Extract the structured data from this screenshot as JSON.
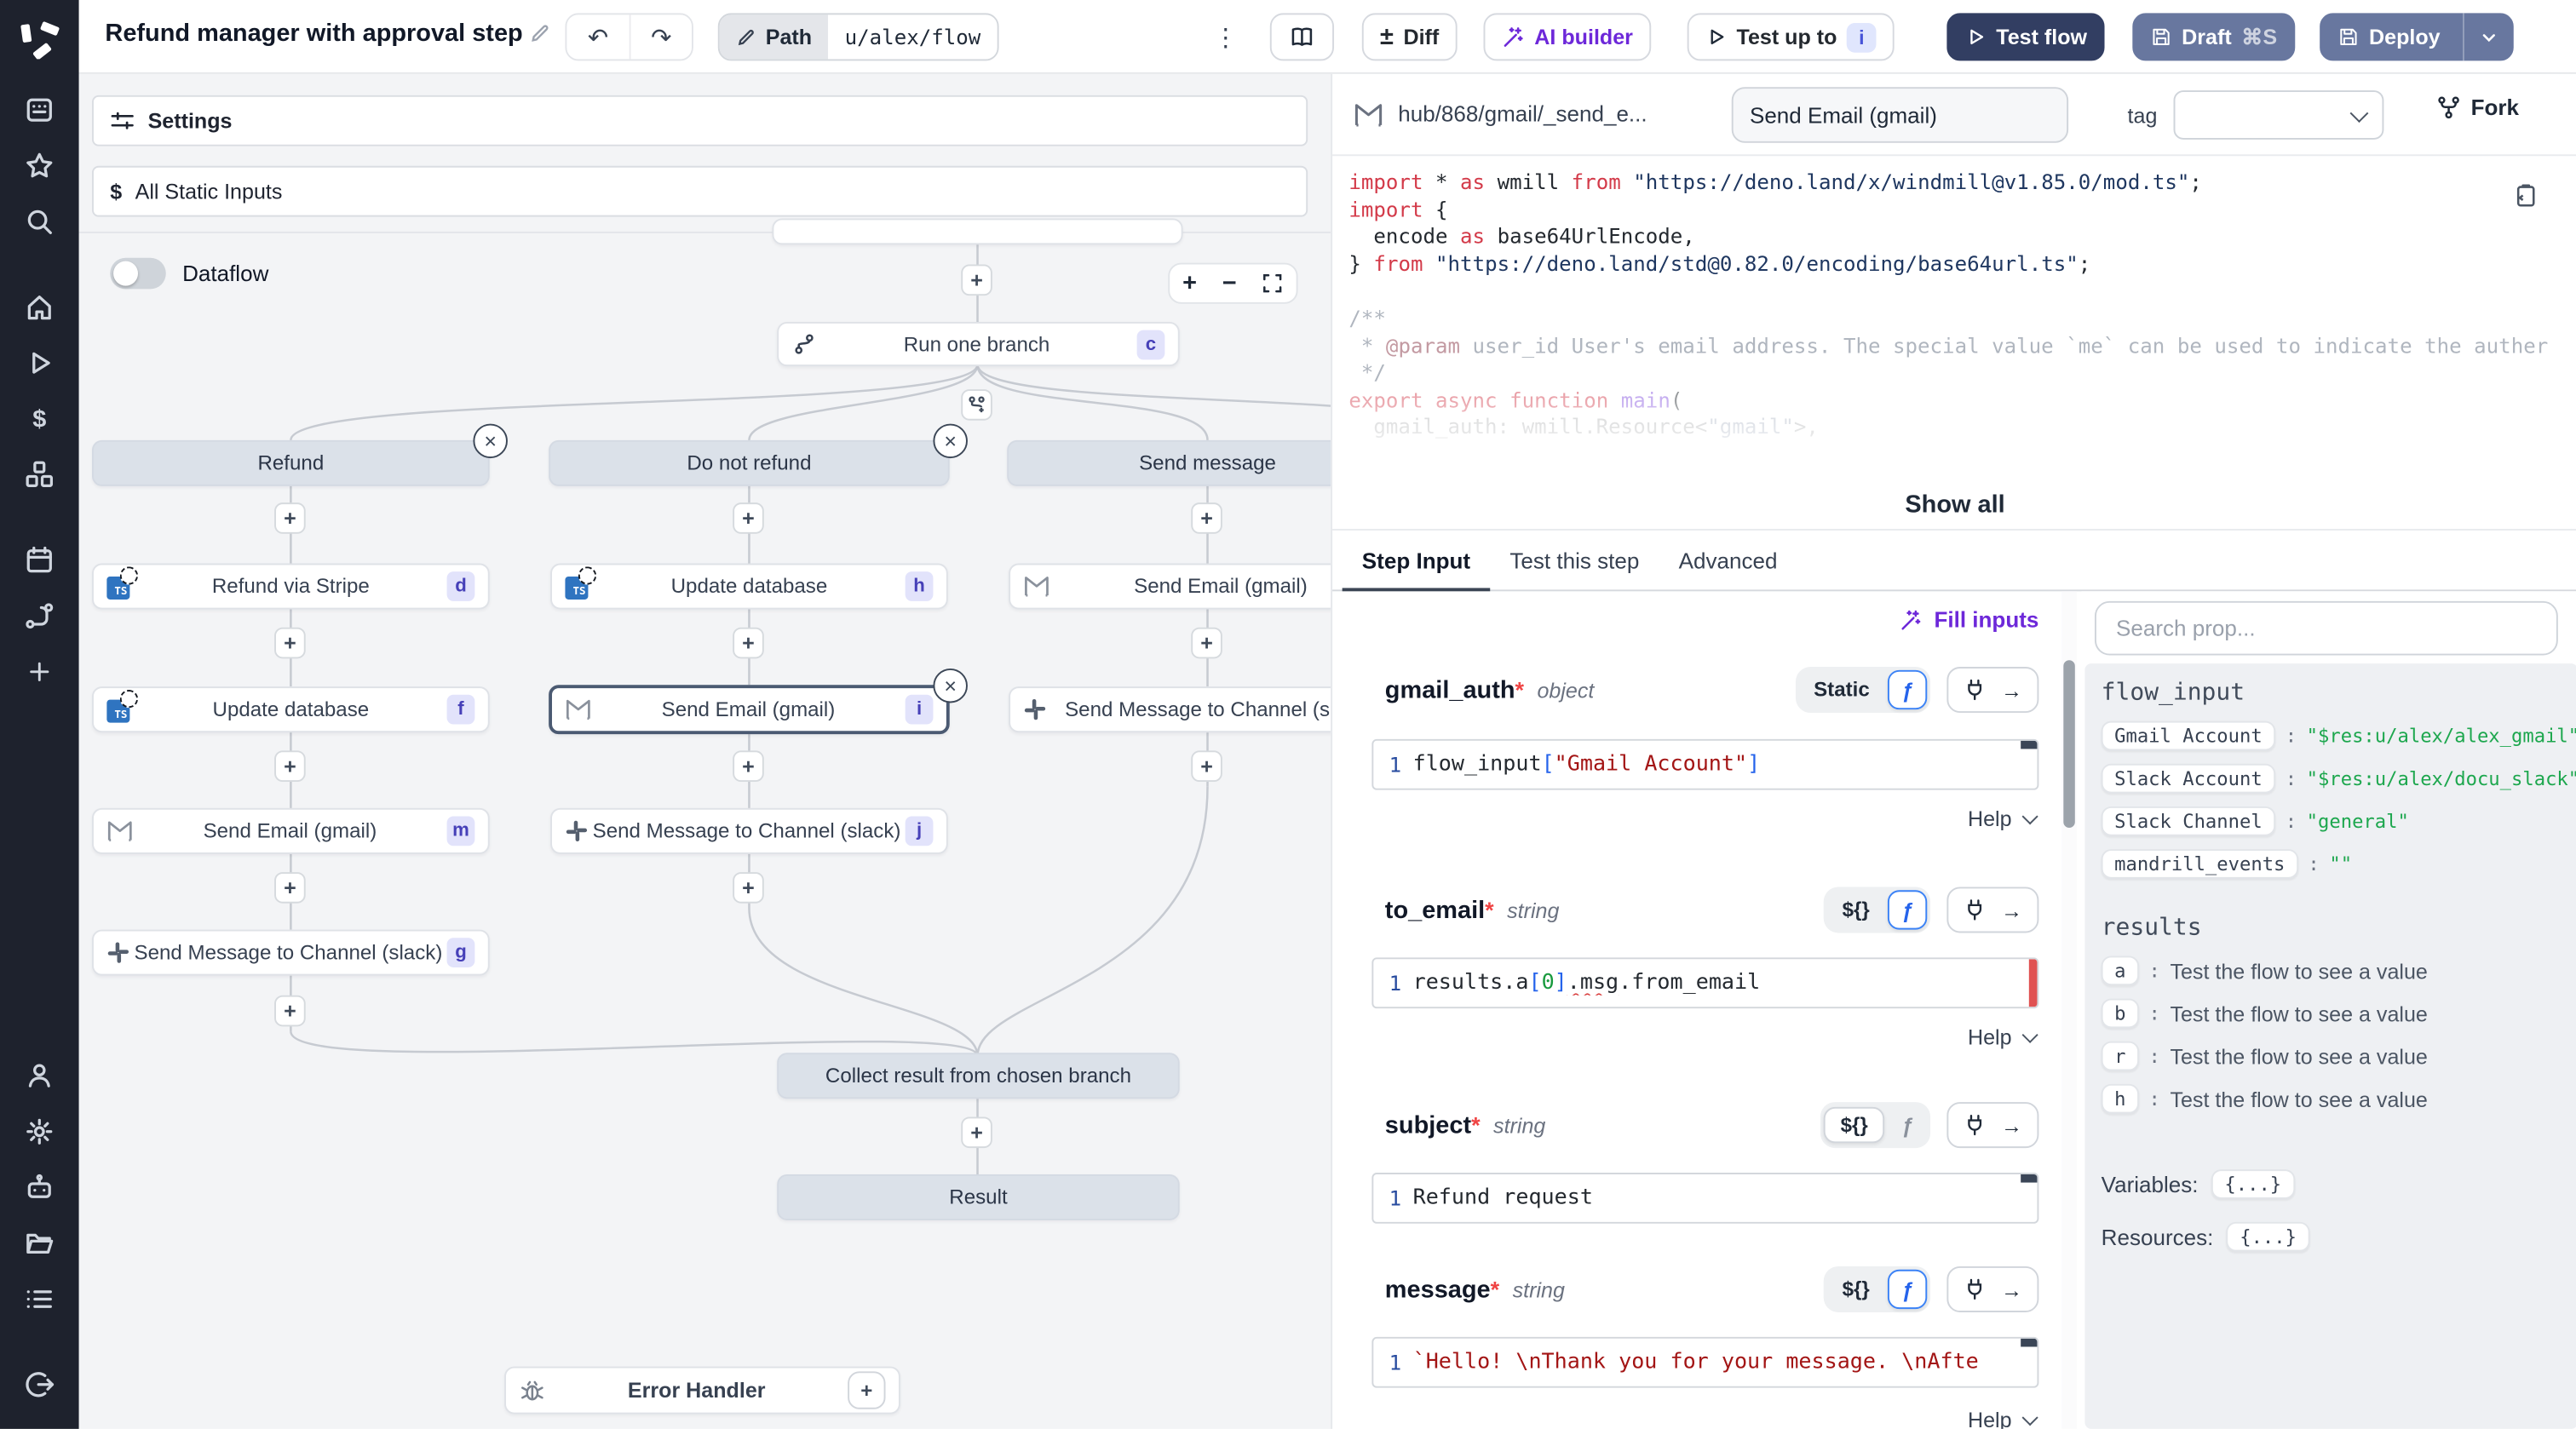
{
  "icons": {
    "add_step": "+",
    "close": "×",
    "zoom_in": "+",
    "zoom_out": "−",
    "kebab": "⋮",
    "undo": "↶",
    "redo": "↷",
    "diff": "±",
    "arrow_right": "→"
  },
  "topbar": {
    "title": "Refund manager with approval step",
    "path_label": "Path",
    "path_value": "u/alex/flow",
    "diff_label": "Diff",
    "ai_builder_label": "AI builder",
    "test_up_to_label": "Test up to",
    "test_up_to_badge": "i",
    "test_flow_label": "Test flow",
    "draft_label": "Draft",
    "draft_shortcut": "⌘S",
    "deploy_label": "Deploy"
  },
  "flow_panel": {
    "settings_label": "Settings",
    "static_inputs_label": "All Static Inputs",
    "static_inputs_icon": "$",
    "dataflow_label": "Dataflow"
  },
  "canvas": {
    "run_node": {
      "label": "Run one branch",
      "badge": "c"
    },
    "branches": [
      {
        "header": "Refund",
        "nodes": [
          {
            "icon": "ts",
            "label": "Refund via Stripe",
            "badge": "d"
          },
          {
            "icon": "ts",
            "label": "Update database",
            "badge": "f"
          },
          {
            "icon": "gmail",
            "label": "Send Email (gmail)",
            "badge": "m"
          },
          {
            "icon": "slack",
            "label": "Send Message to Channel (slack)",
            "badge": "g"
          }
        ]
      },
      {
        "header": "Do not refund",
        "nodes": [
          {
            "icon": "ts",
            "label": "Update database",
            "badge": "h"
          },
          {
            "icon": "gmail",
            "label": "Send Email (gmail)",
            "badge": "i"
          },
          {
            "icon": "slack",
            "label": "Send Message to Channel (slack)",
            "badge": "j"
          }
        ]
      },
      {
        "header": "Send message",
        "nodes": [
          {
            "icon": "gmail",
            "label": "Send Email (gmail)"
          },
          {
            "icon": "slack",
            "label": "Send Message to Channel (slack)"
          }
        ]
      }
    ],
    "collect_label": "Collect result from chosen branch",
    "result_label": "Result",
    "error_handler_label": "Error Handler"
  },
  "inspector": {
    "hub_path": "hub/868/gmail/_send_e...",
    "step_name": "Send Email (gmail)",
    "tag_label": "tag",
    "fork_label": "Fork",
    "show_all_label": "Show all",
    "tabs": [
      {
        "label": "Step Input"
      },
      {
        "label": "Test this step"
      },
      {
        "label": "Advanced"
      }
    ],
    "fill_inputs_label": "Fill inputs",
    "help_label": "Help",
    "required_mark": "*",
    "fn_label": "ƒ",
    "line_no": "1",
    "code": {
      "lines": [
        {
          "toks": [
            {
              "c": "kw",
              "t": "import"
            },
            {
              "c": "pl",
              "t": " * "
            },
            {
              "c": "kw",
              "t": "as"
            },
            {
              "c": "pl",
              "t": " wmill "
            },
            {
              "c": "kw",
              "t": "from"
            },
            {
              "c": "pl",
              "t": " "
            },
            {
              "c": "str",
              "t": "\"https://deno.land/x/windmill@v1.85.0/mod.ts\""
            },
            {
              "c": "pl",
              "t": ";"
            }
          ]
        },
        {
          "toks": [
            {
              "c": "kw",
              "t": "import"
            },
            {
              "c": "pl",
              "t": " {"
            }
          ]
        },
        {
          "toks": [
            {
              "c": "pl",
              "t": "  encode "
            },
            {
              "c": "kw",
              "t": "as"
            },
            {
              "c": "pl",
              "t": " base64UrlEncode,"
            }
          ]
        },
        {
          "toks": [
            {
              "c": "pl",
              "t": "} "
            },
            {
              "c": "kw",
              "t": "from"
            },
            {
              "c": "pl",
              "t": " "
            },
            {
              "c": "str",
              "t": "\"https://deno.land/std@0.82.0/encoding/base64url.ts\""
            },
            {
              "c": "pl",
              "t": ";"
            }
          ]
        },
        {
          "toks": []
        },
        {
          "toks": [
            {
              "c": "cm",
              "t": "/**"
            }
          ]
        },
        {
          "toks": [
            {
              "c": "cm",
              "t": " * "
            },
            {
              "c": "cmk",
              "t": "@param"
            },
            {
              "c": "cm",
              "t": " user_id User's email address. The special value `me` can be used to indicate the auther"
            }
          ]
        },
        {
          "toks": [
            {
              "c": "cm",
              "t": " */"
            }
          ]
        },
        {
          "toks": [
            {
              "c": "kw",
              "t": "export"
            },
            {
              "c": "pl",
              "t": " "
            },
            {
              "c": "kw",
              "t": "async"
            },
            {
              "c": "pl",
              "t": " "
            },
            {
              "c": "kw",
              "t": "function"
            },
            {
              "c": "pl",
              "t": " "
            },
            {
              "c": "fn",
              "t": "main"
            },
            {
              "c": "pl",
              "t": "("
            }
          ]
        },
        {
          "toks": [
            {
              "c": "pl",
              "t": "  gmail_auth: wmill.Resource<"
            },
            {
              "c": "str",
              "t": "\"gmail\""
            },
            {
              "c": "pl",
              "t": ">,"
            }
          ]
        }
      ]
    },
    "fields": [
      {
        "name": "gmail_auth",
        "type": "object",
        "left_label": "Static",
        "tokens": [
          {
            "c": "pl",
            "t": "flow_input"
          },
          {
            "c": "br",
            "t": "["
          },
          {
            "c": "strr",
            "t": "\"Gmail Account\""
          },
          {
            "c": "br",
            "t": "]"
          }
        ]
      },
      {
        "name": "to_email",
        "type": "string",
        "left_label": "${}",
        "tokens": [
          {
            "c": "pl",
            "t": "results.a"
          },
          {
            "c": "br",
            "t": "["
          },
          {
            "c": "num",
            "t": "0"
          },
          {
            "c": "br",
            "t": "]"
          },
          {
            "c": "wavy",
            "t": ".msg"
          },
          {
            "c": "pl",
            "t": ".from_email"
          }
        ]
      },
      {
        "name": "subject",
        "type": "string",
        "left_label": "${}",
        "tokens": [
          {
            "c": "pl",
            "t": "Refund request"
          }
        ]
      },
      {
        "name": "message",
        "type": "string",
        "left_label": "${}",
        "tokens": [
          {
            "c": "strr",
            "t": "`Hello! \\nThank you for your message. \\nAfte"
          }
        ]
      }
    ]
  },
  "context": {
    "search_placeholder": "Search prop...",
    "colon": ":",
    "flow_input_title": "flow_input",
    "flow_input_entries": [
      {
        "key": "Gmail Account",
        "value": "\"$res:u/alex/alex_gmail\""
      },
      {
        "key": "Slack Account",
        "value": "\"$res:u/alex/docu_slack\""
      },
      {
        "key": "Slack Channel",
        "value": "\"general\""
      },
      {
        "key": "mandrill_events",
        "value": "\"\""
      }
    ],
    "results_title": "results",
    "results_entries": [
      {
        "key": "a",
        "value": "Test the flow to see a value"
      },
      {
        "key": "b",
        "value": "Test the flow to see a value"
      },
      {
        "key": "r",
        "value": "Test the flow to see a value"
      },
      {
        "key": "h",
        "value": "Test the flow to see a value"
      }
    ],
    "variables_label": "Variables:",
    "variables_value": "{...}",
    "resources_label": "Resources:",
    "resources_value": "{...}"
  }
}
